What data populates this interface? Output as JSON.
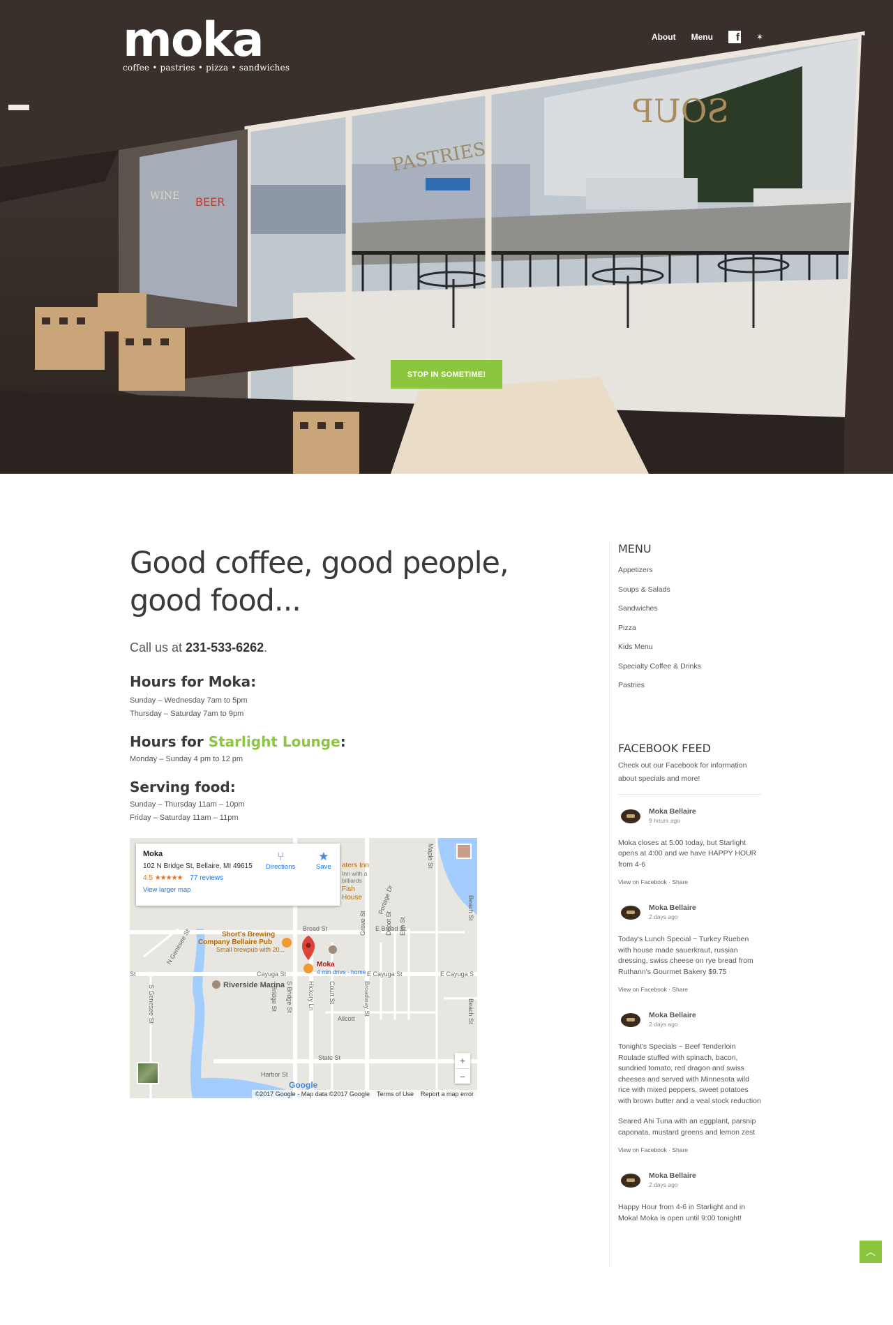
{
  "brand": {
    "name": "moka",
    "tagline": "coffee • pastries • pizza • sandwiches"
  },
  "nav": {
    "about": "About",
    "menu": "Menu",
    "facebook_icon": "facebook-icon",
    "extra_icon": "star-icon"
  },
  "hero": {
    "cta": "STOP IN SOMETIME!",
    "window_sign_1": "SOUP",
    "window_sign_2": "PASTRIES",
    "window_sign_3": "WINE",
    "window_sign_4": "BEER"
  },
  "main": {
    "headline": "Good coffee, good people, good food...",
    "call_prefix": "Call us at ",
    "phone": "231-533-6262",
    "call_suffix": ".",
    "hours_moka": {
      "title": "Hours for Moka:",
      "lines": [
        "Sunday – Wednesday 7am to 5pm",
        "Thursday – Saturday 7am to 9pm"
      ]
    },
    "hours_lounge": {
      "title_prefix": "Hours for ",
      "title_link": "Starlight Lounge",
      "title_suffix": ":",
      "lines": [
        "Monday – Sunday 4 pm to 12 pm"
      ]
    },
    "serving": {
      "title": "Serving food:",
      "lines": [
        "Sunday – Thursday 11am – 10pm",
        "Friday – Saturday 11am – 11pm"
      ]
    }
  },
  "map": {
    "place_name": "Moka",
    "address": "102 N Bridge St, Bellaire, MI 49615",
    "rating": "4.5",
    "stars": "★★★★★",
    "reviews": "77 reviews",
    "larger_map": "View larger map",
    "directions": "Directions",
    "save": "Save",
    "labels": {
      "shorts_1": "Short's Brewing",
      "shorts_2": "Company Bellaire Pub",
      "shorts_3": "Small brewpub with 20...",
      "pin_name": "Moka",
      "pin_sub": "4 min drive - home",
      "riverside": "Riverside Marina",
      "inn_1": "aters Inn",
      "inn_2": "Inn with a",
      "inn_3": "billiards",
      "inn_4": "Fish",
      "inn_5": "House",
      "broad": "Broad St",
      "e_broad": "E Broad St",
      "cayuga": "Cayuga St",
      "e_cayuga": "E Cayuga St",
      "e_cayuga2": "E Cayuga S",
      "allcott": "Allcott",
      "state": "State St",
      "harbor": "Harbor St",
      "maple": "Maple St",
      "beach": "Beach St",
      "beach2": "Beach St",
      "genesee": "N Genesee St",
      "s_genesee": "S Genesee St",
      "s_genesee2": "S Genesee St",
      "s_bridge": "S Bridge St",
      "bridge": "Bridge St",
      "hickory": "Hickory Ln",
      "court": "Court St",
      "broadway": "Broadway St",
      "grove": "Grove St",
      "depot": "Depot St",
      "elm": "Elm St",
      "portage": "Portage Dr",
      "st_left": "St"
    },
    "google": "Google",
    "footer": [
      "©2017 Google - Map data ©2017 Google",
      "Terms of Use",
      "Report a map error"
    ],
    "zoom_in": "+",
    "zoom_out": "−"
  },
  "sidebar": {
    "menu_title": "MENU",
    "menu_items": [
      "Appetizers",
      "Soups & Salads",
      "Sandwiches",
      "Pizza",
      "Kids Menu",
      "Specialty Coffee & Drinks",
      "Pastries"
    ],
    "fb_title": "FACEBOOK FEED",
    "fb_intro": "Check out our Facebook for information about specials and more!",
    "posts": [
      {
        "author": "Moka Bellaire",
        "time": "9 hours ago",
        "body": [
          "Moka closes at 5:00 today, but Starlight opens at 4:00 and we have HAPPY HOUR from 4-6"
        ],
        "links": "View on Facebook · Share"
      },
      {
        "author": "Moka Bellaire",
        "time": "2 days ago",
        "body": [
          "Today's Lunch Special ~ Turkey Rueben with house made sauerkraut, russian dressing, swiss cheese on rye bread from Ruthann's Gourmet Bakery $9.75"
        ],
        "links": "View on Facebook · Share"
      },
      {
        "author": "Moka Bellaire",
        "time": "2 days ago",
        "body": [
          "Tonight's Specials ~ Beef Tenderloin Roulade stuffed with spinach, bacon, sundried tomato, red dragon and swiss cheeses and served with Minnesota wild rice with mixed peppers, sweet potatoes with brown butter and a veal stock reduction",
          "Seared Ahi Tuna with an eggplant, parsnip caponata, mustard greens and lemon zest"
        ],
        "links": "View on Facebook · Share"
      },
      {
        "author": "Moka Bellaire",
        "time": "2 days ago",
        "body": [
          "Happy Hour from 4-6 in Starlight and in Moka! Moka is open until 9:00 tonight!"
        ],
        "links": ""
      }
    ]
  },
  "scroll_top_icon": "chevron-up-icon",
  "colors": {
    "accent_green": "#8cc63f",
    "text_dark": "#3a3a3a",
    "map_link_blue": "#1a73e8"
  }
}
